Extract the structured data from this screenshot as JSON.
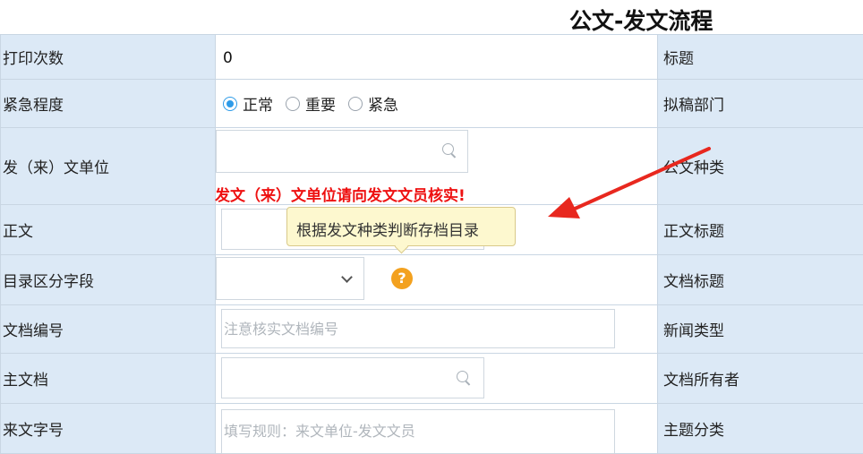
{
  "page_title": "公文-发文流程",
  "rows": {
    "print_count": {
      "label": "打印次数",
      "value": "0",
      "right_label": "标题"
    },
    "urgency": {
      "label": "紧急程度",
      "options": [
        "正常",
        "重要",
        "紧急"
      ],
      "selected": "正常",
      "right_label": "拟稿部门"
    },
    "sender_unit": {
      "label": "发（来）文单位",
      "right_label": "公文种类"
    },
    "body_text": {
      "label": "正文",
      "right_label": "正文标题"
    },
    "catalog_field": {
      "label": "目录区分字段",
      "right_label": "文档标题"
    },
    "doc_number": {
      "label": "文档编号",
      "placeholder": "注意核实文档编号",
      "right_label": "新闻类型"
    },
    "main_doc": {
      "label": "主文档",
      "right_label": "文档所有者"
    },
    "incoming_number": {
      "label": "来文字号",
      "placeholder": "填写规则：来文单位-发文文员",
      "right_label": "主题分类"
    }
  },
  "warning_text": "发文（来）文单位请向发文文员核实!",
  "tooltip_text": "根据发文种类判断存档目录",
  "colors": {
    "label_bg": "#dce9f6",
    "warning": "#ee1111",
    "radio_selected": "#2e9be8",
    "help_icon": "#f3a11f",
    "arrow": "#e8281f"
  },
  "icons": {
    "search": "search-icon",
    "dropdown": "chevron-down-icon",
    "help": "question-circle-icon"
  }
}
